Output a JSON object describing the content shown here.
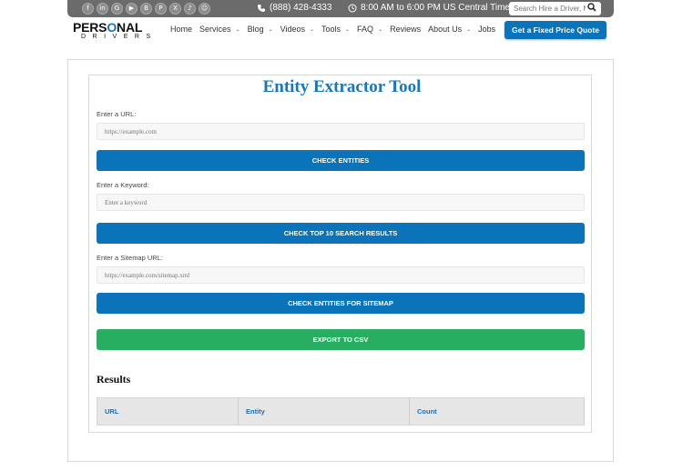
{
  "topbar": {
    "socials": [
      {
        "icon": "facebook-icon",
        "glyph": "f"
      },
      {
        "icon": "linkedin-icon",
        "glyph": "in"
      },
      {
        "icon": "google-icon",
        "glyph": "G"
      },
      {
        "icon": "youtube-icon",
        "glyph": "▶"
      },
      {
        "icon": "blogger-icon",
        "glyph": "B"
      },
      {
        "icon": "pinterest-icon",
        "glyph": "P"
      },
      {
        "icon": "x-icon",
        "glyph": "X"
      },
      {
        "icon": "tiktok-icon",
        "glyph": "♪"
      },
      {
        "icon": "snapchat-icon",
        "glyph": "☺"
      }
    ],
    "phone": "(888) 428-4333",
    "hours": "8:00 AM to 6:00 PM US Central Time",
    "search_placeholder": "Search Hire a Driver, M"
  },
  "logo": {
    "line1_a": "PERS",
    "line1_o": "O",
    "line1_b": "NAL",
    "line2": "DRIVERS"
  },
  "nav": {
    "items": [
      {
        "label": "Home",
        "dropdown": false
      },
      {
        "label": "Services",
        "dropdown": true
      },
      {
        "label": "Blog",
        "dropdown": true
      },
      {
        "label": "Videos",
        "dropdown": true
      },
      {
        "label": "Tools",
        "dropdown": true
      },
      {
        "label": "FAQ",
        "dropdown": true
      },
      {
        "label": "Reviews",
        "dropdown": false
      },
      {
        "label": "About Us",
        "dropdown": true
      },
      {
        "label": "Jobs",
        "dropdown": false
      }
    ],
    "cta": "Get a Fixed Price Quote"
  },
  "tool": {
    "title": "Entity Extractor Tool",
    "url_label": "Enter a URL:",
    "url_placeholder": "https://example.com",
    "check_entities": "CHECK ENTITIES",
    "keyword_label": "Enter a Keyword:",
    "keyword_placeholder": "Enter a keyword",
    "check_top10": "CHECK TOP 10 SEARCH RESULTS",
    "sitemap_label": "Enter a Sitemap URL:",
    "sitemap_placeholder": "https://example.com/sitemap.xml",
    "check_sitemap": "CHECK ENTITIES FOR SITEMAP",
    "export_csv": "EXPORT TO CSV",
    "results_title": "Results",
    "columns": [
      "URL",
      "Entity",
      "Count"
    ]
  },
  "colors": {
    "accent": "#0a73b9",
    "export": "#27ae60",
    "topbar": "#6b6b6b",
    "title": "#1b75bb"
  }
}
